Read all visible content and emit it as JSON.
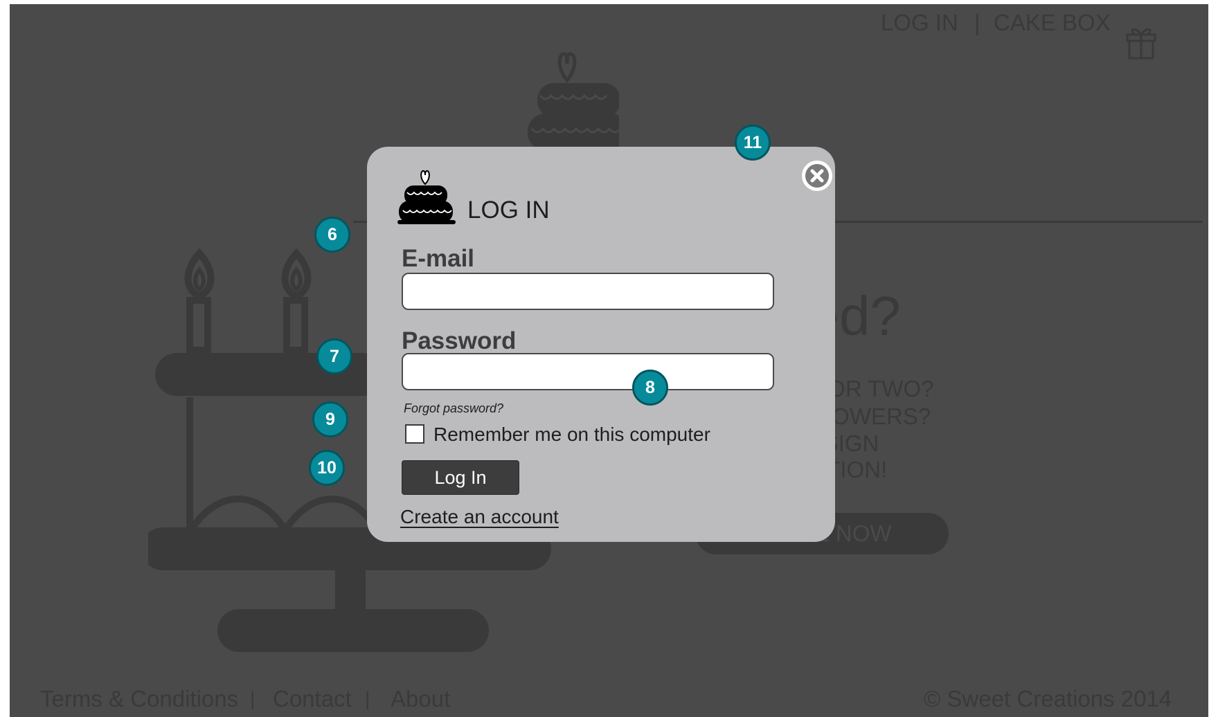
{
  "nav": {
    "login": "LOG IN",
    "separator": "|",
    "cake_box": "CAKE BOX"
  },
  "hero": {
    "heading": "nspired?",
    "lines": [
      "S OR TWO?",
      "OR FLOWERS?",
      "AND DESIGN",
      "CREATION!"
    ],
    "cta": "IZE NOW"
  },
  "footer": {
    "terms": "Terms & Conditions",
    "separator": "|",
    "contact": "Contact",
    "about": "About",
    "copyright": "© Sweet Creations 2014"
  },
  "modal": {
    "title": "LOG IN",
    "email_label": "E-mail",
    "email_value": "",
    "password_label": "Password",
    "password_value": "",
    "forgot_password": "Forgot password?",
    "remember_me": "Remember me on this computer",
    "remember_checked": false,
    "login_button": "Log In",
    "create_account": "Create an account"
  },
  "markers": [
    "6",
    "7",
    "8",
    "9",
    "10",
    "11"
  ],
  "colors": {
    "overlay": "#4a4a4a",
    "modal_bg": "#bcbcbf",
    "marker": "#078b9b",
    "button": "#3d3d3d"
  },
  "icons": [
    "gift-icon",
    "cake-logo-icon",
    "birthday-cake-illustration",
    "close-icon"
  ]
}
